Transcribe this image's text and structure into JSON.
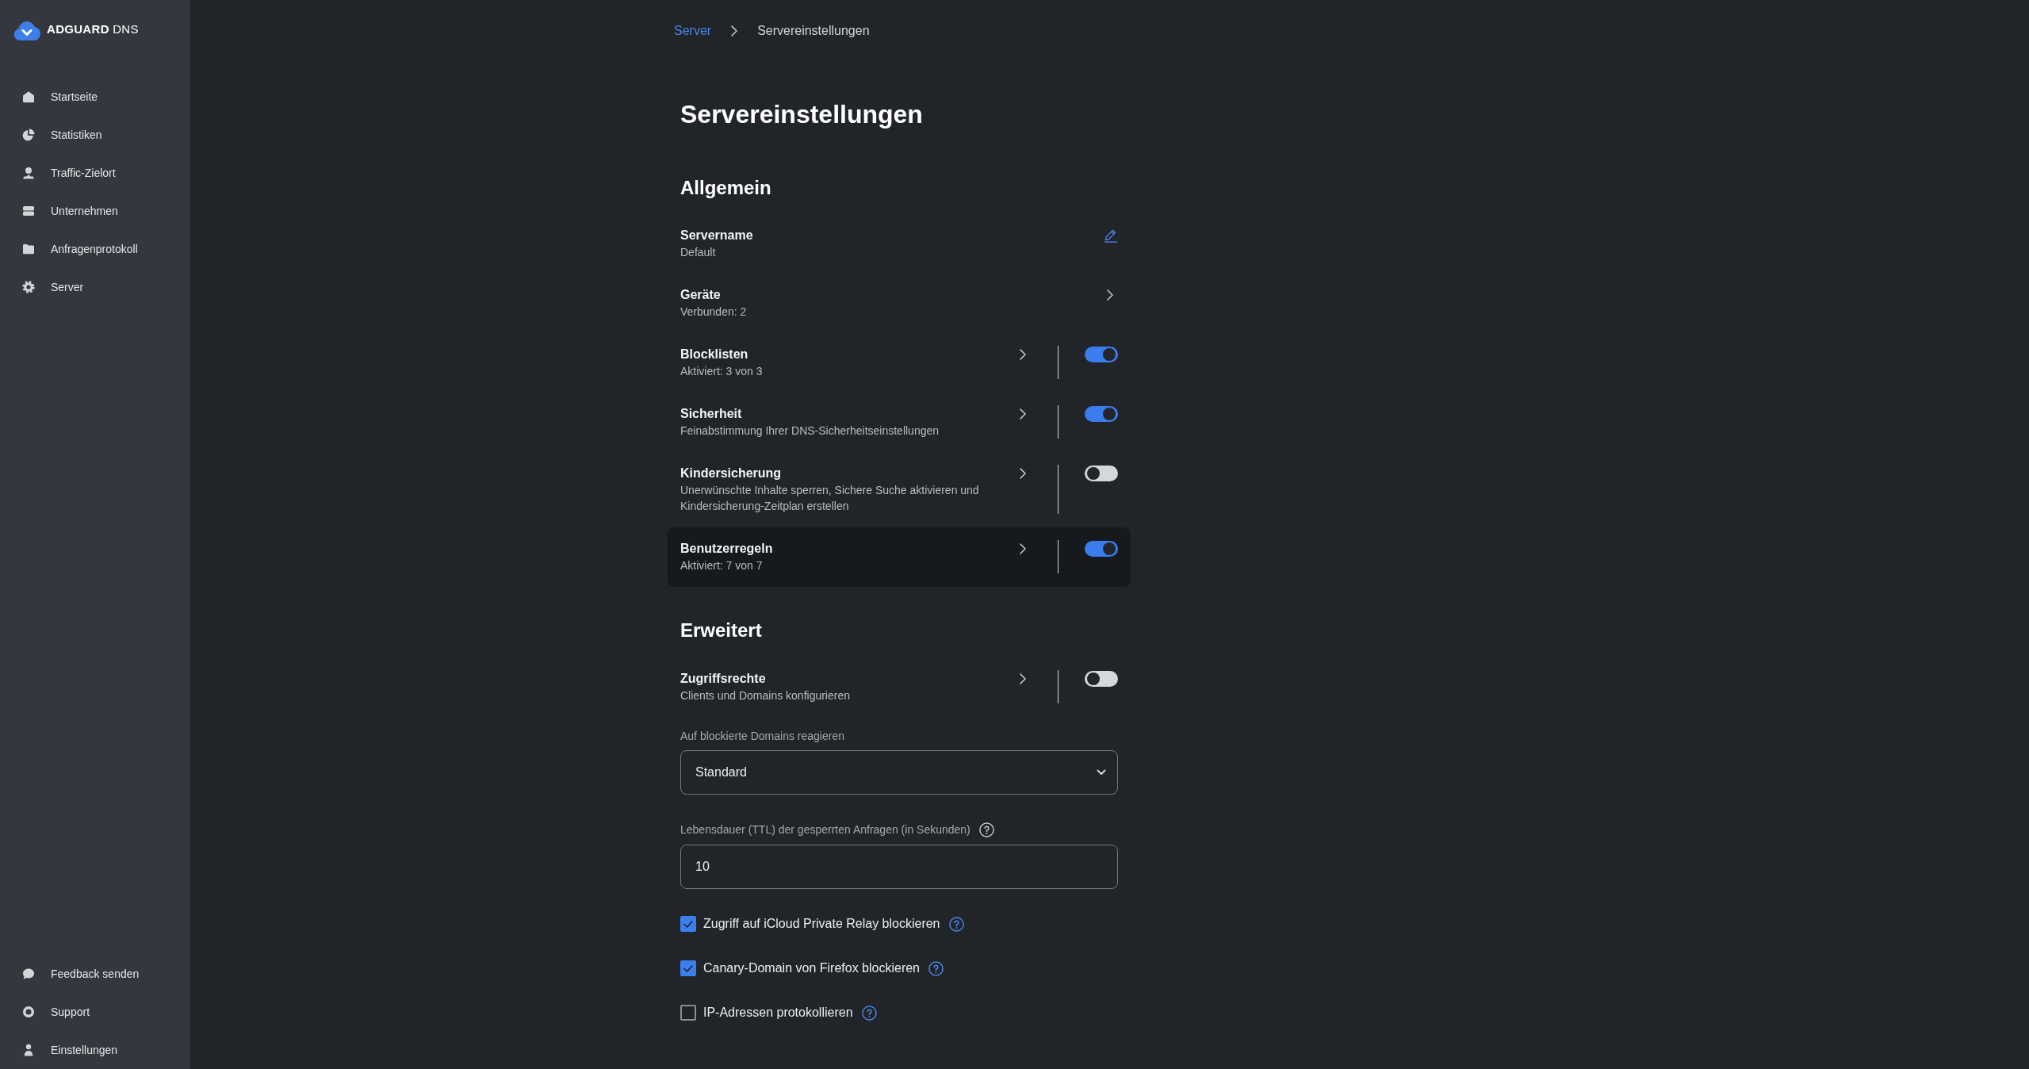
{
  "sidebar": {
    "logo": "**ADGUARD** DNS",
    "nav": [
      "Startseite",
      "Statistiken",
      "Traffic-Zielort",
      "Unternehmen",
      "Anfragenprotokoll",
      "Server"
    ],
    "footer": [
      "Feedback senden",
      "Support",
      "Einstellungen"
    ]
  },
  "breadcrumb": {
    "parent": "Server",
    "current": "Servereinstellungen"
  },
  "page_title": "Servereinstellungen",
  "sections": [
    {
      "title": "Allgemein",
      "items": [
        {
          "kind": "edit",
          "title": "Servername",
          "subtitle": "Default",
          "highlighted": false
        },
        {
          "kind": "link",
          "title": "Geräte",
          "subtitle": "Verbunden: 2",
          "highlighted": false
        },
        {
          "kind": "toggle",
          "title": "Blocklisten",
          "subtitle": "Aktiviert: 3 von 3",
          "on": true,
          "highlighted": false
        },
        {
          "kind": "toggle",
          "title": "Sicherheit",
          "subtitle": "Feinabstimmung Ihrer DNS-Sicherheitseinstellungen",
          "on": true,
          "highlighted": false
        },
        {
          "kind": "toggle",
          "title": "Kindersicherung",
          "subtitle": "Unerwünschte Inhalte sperren, Sichere Suche aktivieren und Kindersicherung-Zeitplan erstellen",
          "on": false,
          "highlighted": false
        },
        {
          "kind": "toggle",
          "title": "Benutzerregeln",
          "subtitle": "Aktiviert: 7 von 7",
          "on": true,
          "highlighted": true
        }
      ]
    },
    {
      "title": "Erweitert",
      "items": [
        {
          "kind": "toggle",
          "title": "Zugriffsrechte",
          "subtitle": "Clients und Domains konfigurieren",
          "on": false,
          "highlighted": false
        },
        {
          "kind": "select",
          "label": "Auf blockierte Domains reagieren",
          "value": "Standard"
        },
        {
          "kind": "number",
          "label": "Lebensdauer (TTL) der gesperrten Anfragen (in Sekunden)",
          "value": "10"
        },
        {
          "kind": "checkbox",
          "label": "Zugriff auf iCloud Private Relay blockieren",
          "checked": true
        },
        {
          "kind": "checkbox",
          "label": "Canary-Domain von Firefox blockieren",
          "checked": true
        },
        {
          "kind": "checkbox",
          "label": "IP-Adressen protokollieren",
          "checked": false
        }
      ]
    }
  ]
}
